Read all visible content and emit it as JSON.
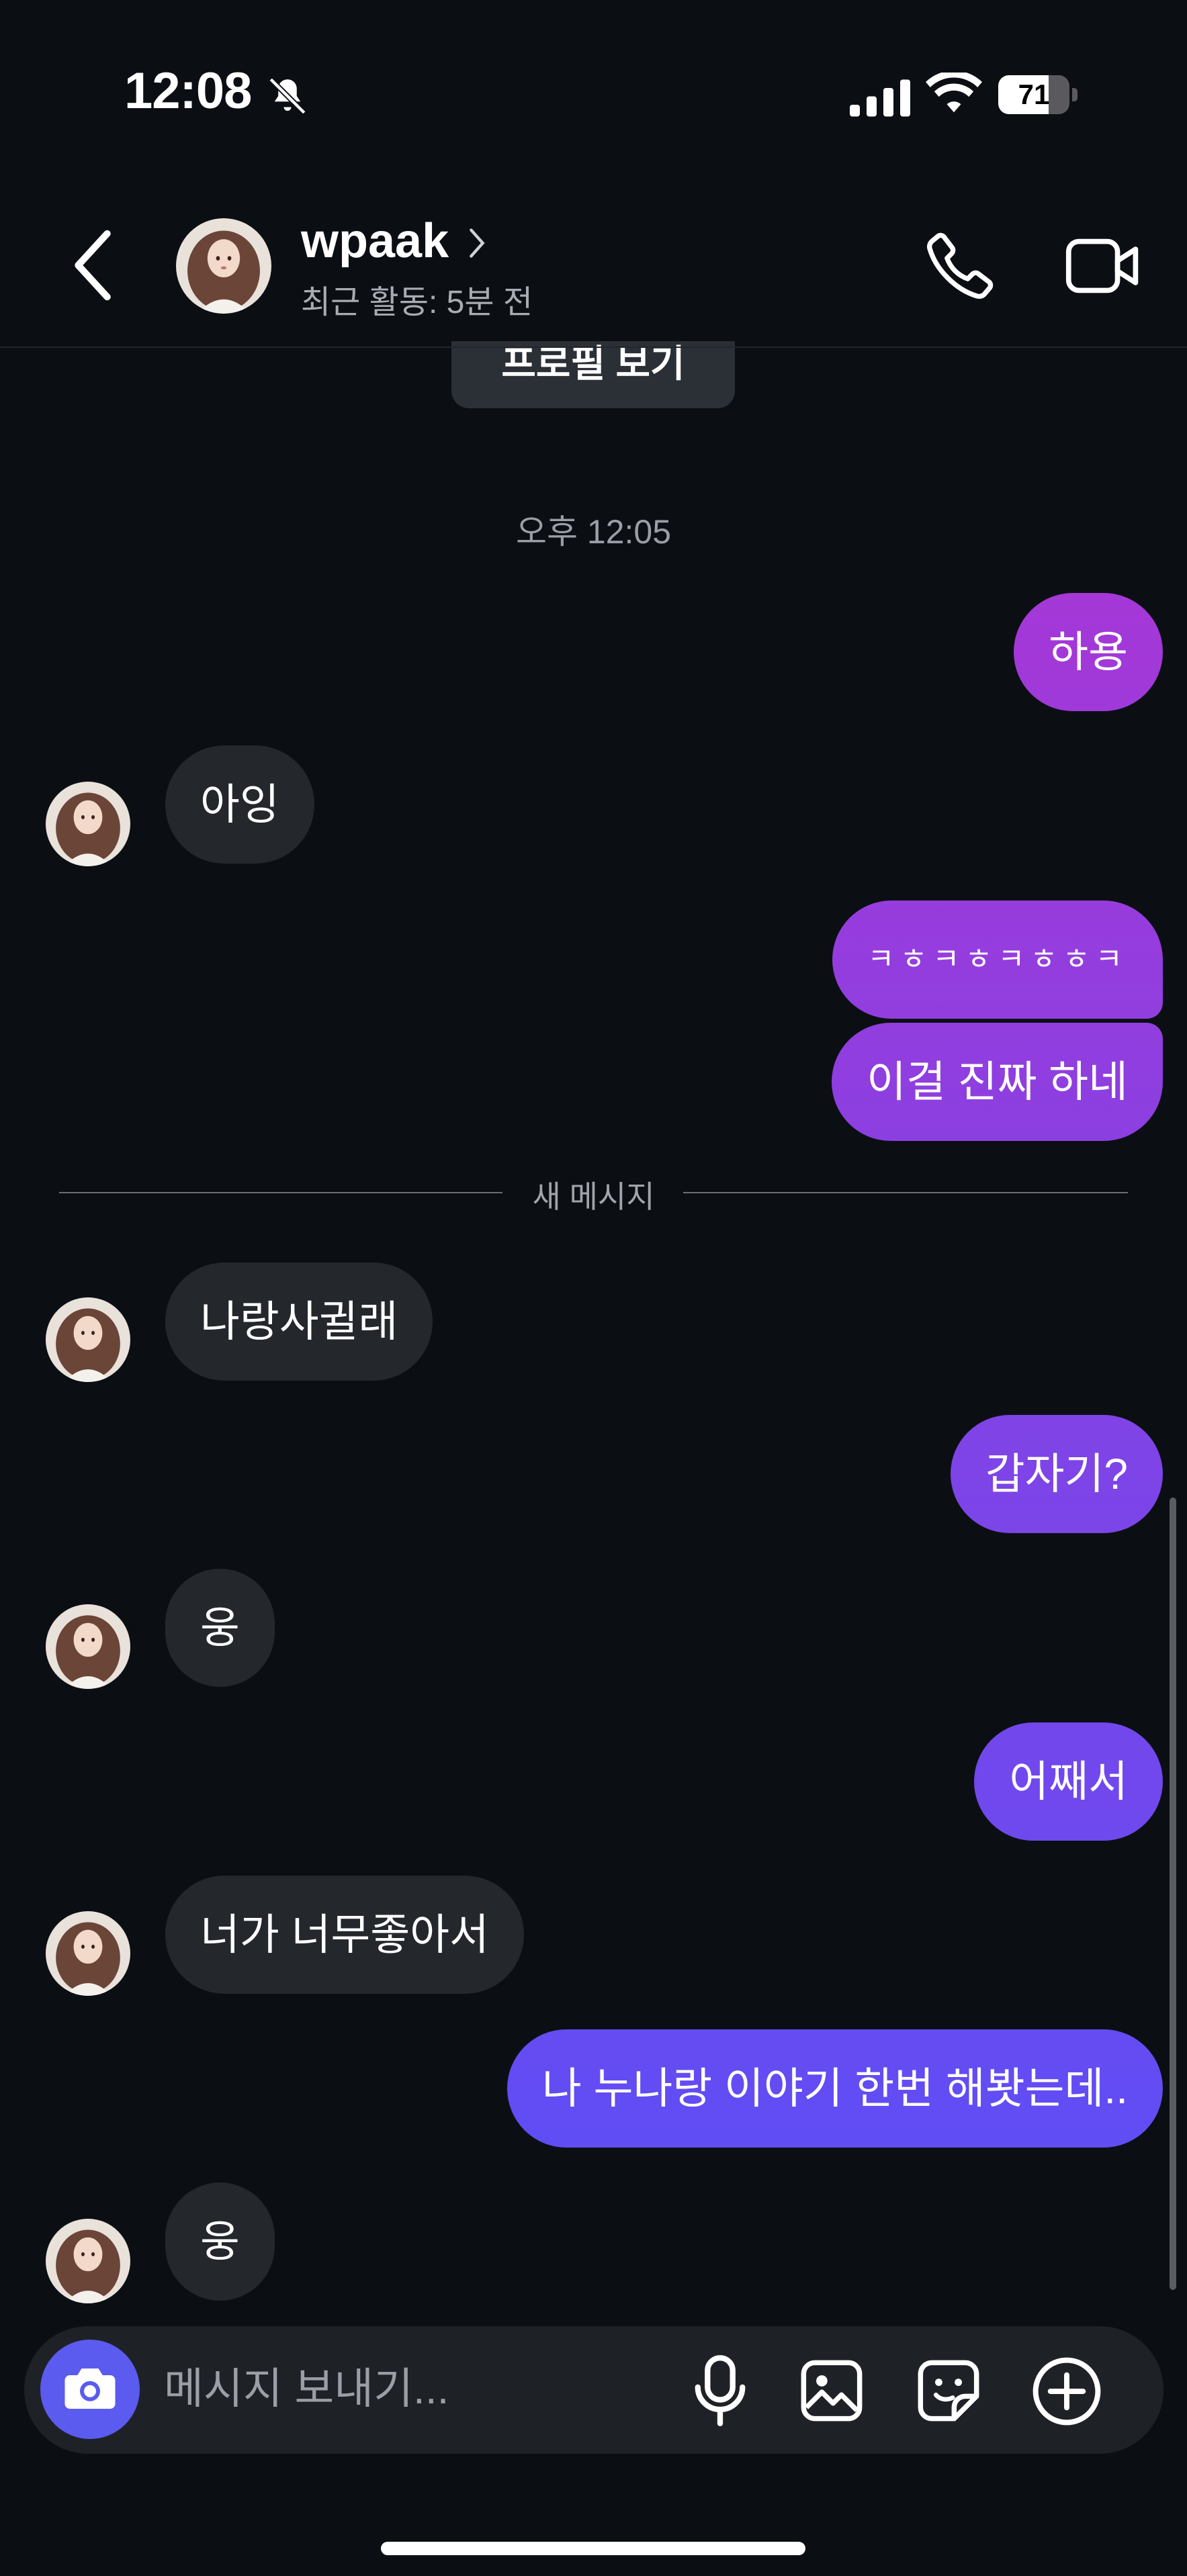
{
  "status_bar": {
    "time": "12:08",
    "battery": "71",
    "battery_level": 0.71
  },
  "header": {
    "username": "wpaak",
    "activity": "최근 활동: 5분 전",
    "icons": {
      "back": "chevron-left-icon",
      "call": "phone-icon",
      "video": "video-camera-icon",
      "profile_chevron": "chevron-right-icon"
    }
  },
  "chat": {
    "profile_button": "프로필 보기",
    "timestamp": "오후 12:05",
    "new_message_divider": "새 메시지",
    "messages": [
      {
        "from": "me",
        "text": "하용"
      },
      {
        "from": "them",
        "text": "아잉"
      },
      {
        "from": "me",
        "text": "ㅋㅎㅋㅎㅋㅎㅎㅋ"
      },
      {
        "from": "me",
        "text": "이걸 진짜 하네"
      },
      {
        "from": "them",
        "text": "나랑사귈래"
      },
      {
        "from": "me",
        "text": "갑자기?"
      },
      {
        "from": "them",
        "text": "웅"
      },
      {
        "from": "me",
        "text": "어째서"
      },
      {
        "from": "them",
        "text": "너가 너무좋아서"
      },
      {
        "from": "me",
        "text": "나 누나랑 이야기 한번 해봣는데.."
      },
      {
        "from": "them",
        "text": "웅"
      }
    ]
  },
  "composer": {
    "placeholder": "메시지 보내기...",
    "icons": [
      "camera-icon",
      "microphone-icon",
      "image-icon",
      "sticker-icon",
      "plus-circle-icon"
    ]
  },
  "colors": {
    "background": "#0b0f14",
    "incoming_bubble": "#24272c",
    "outgoing_gradient_top": "#a737d6",
    "outgoing_gradient_bottom": "#5d4ef5",
    "camera_button": "#5b5bf0"
  }
}
